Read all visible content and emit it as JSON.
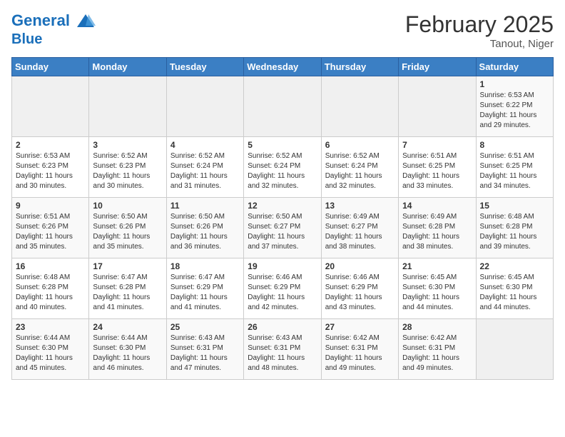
{
  "header": {
    "logo_line1": "General",
    "logo_line2": "Blue",
    "month_year": "February 2025",
    "location": "Tanout, Niger"
  },
  "weekdays": [
    "Sunday",
    "Monday",
    "Tuesday",
    "Wednesday",
    "Thursday",
    "Friday",
    "Saturday"
  ],
  "weeks": [
    [
      {
        "day": "",
        "info": ""
      },
      {
        "day": "",
        "info": ""
      },
      {
        "day": "",
        "info": ""
      },
      {
        "day": "",
        "info": ""
      },
      {
        "day": "",
        "info": ""
      },
      {
        "day": "",
        "info": ""
      },
      {
        "day": "1",
        "info": "Sunrise: 6:53 AM\nSunset: 6:22 PM\nDaylight: 11 hours and 29 minutes."
      }
    ],
    [
      {
        "day": "2",
        "info": "Sunrise: 6:53 AM\nSunset: 6:23 PM\nDaylight: 11 hours and 30 minutes."
      },
      {
        "day": "3",
        "info": "Sunrise: 6:52 AM\nSunset: 6:23 PM\nDaylight: 11 hours and 30 minutes."
      },
      {
        "day": "4",
        "info": "Sunrise: 6:52 AM\nSunset: 6:24 PM\nDaylight: 11 hours and 31 minutes."
      },
      {
        "day": "5",
        "info": "Sunrise: 6:52 AM\nSunset: 6:24 PM\nDaylight: 11 hours and 32 minutes."
      },
      {
        "day": "6",
        "info": "Sunrise: 6:52 AM\nSunset: 6:24 PM\nDaylight: 11 hours and 32 minutes."
      },
      {
        "day": "7",
        "info": "Sunrise: 6:51 AM\nSunset: 6:25 PM\nDaylight: 11 hours and 33 minutes."
      },
      {
        "day": "8",
        "info": "Sunrise: 6:51 AM\nSunset: 6:25 PM\nDaylight: 11 hours and 34 minutes."
      }
    ],
    [
      {
        "day": "9",
        "info": "Sunrise: 6:51 AM\nSunset: 6:26 PM\nDaylight: 11 hours and 35 minutes."
      },
      {
        "day": "10",
        "info": "Sunrise: 6:50 AM\nSunset: 6:26 PM\nDaylight: 11 hours and 35 minutes."
      },
      {
        "day": "11",
        "info": "Sunrise: 6:50 AM\nSunset: 6:26 PM\nDaylight: 11 hours and 36 minutes."
      },
      {
        "day": "12",
        "info": "Sunrise: 6:50 AM\nSunset: 6:27 PM\nDaylight: 11 hours and 37 minutes."
      },
      {
        "day": "13",
        "info": "Sunrise: 6:49 AM\nSunset: 6:27 PM\nDaylight: 11 hours and 38 minutes."
      },
      {
        "day": "14",
        "info": "Sunrise: 6:49 AM\nSunset: 6:28 PM\nDaylight: 11 hours and 38 minutes."
      },
      {
        "day": "15",
        "info": "Sunrise: 6:48 AM\nSunset: 6:28 PM\nDaylight: 11 hours and 39 minutes."
      }
    ],
    [
      {
        "day": "16",
        "info": "Sunrise: 6:48 AM\nSunset: 6:28 PM\nDaylight: 11 hours and 40 minutes."
      },
      {
        "day": "17",
        "info": "Sunrise: 6:47 AM\nSunset: 6:28 PM\nDaylight: 11 hours and 41 minutes."
      },
      {
        "day": "18",
        "info": "Sunrise: 6:47 AM\nSunset: 6:29 PM\nDaylight: 11 hours and 41 minutes."
      },
      {
        "day": "19",
        "info": "Sunrise: 6:46 AM\nSunset: 6:29 PM\nDaylight: 11 hours and 42 minutes."
      },
      {
        "day": "20",
        "info": "Sunrise: 6:46 AM\nSunset: 6:29 PM\nDaylight: 11 hours and 43 minutes."
      },
      {
        "day": "21",
        "info": "Sunrise: 6:45 AM\nSunset: 6:30 PM\nDaylight: 11 hours and 44 minutes."
      },
      {
        "day": "22",
        "info": "Sunrise: 6:45 AM\nSunset: 6:30 PM\nDaylight: 11 hours and 44 minutes."
      }
    ],
    [
      {
        "day": "23",
        "info": "Sunrise: 6:44 AM\nSunset: 6:30 PM\nDaylight: 11 hours and 45 minutes."
      },
      {
        "day": "24",
        "info": "Sunrise: 6:44 AM\nSunset: 6:30 PM\nDaylight: 11 hours and 46 minutes."
      },
      {
        "day": "25",
        "info": "Sunrise: 6:43 AM\nSunset: 6:31 PM\nDaylight: 11 hours and 47 minutes."
      },
      {
        "day": "26",
        "info": "Sunrise: 6:43 AM\nSunset: 6:31 PM\nDaylight: 11 hours and 48 minutes."
      },
      {
        "day": "27",
        "info": "Sunrise: 6:42 AM\nSunset: 6:31 PM\nDaylight: 11 hours and 49 minutes."
      },
      {
        "day": "28",
        "info": "Sunrise: 6:42 AM\nSunset: 6:31 PM\nDaylight: 11 hours and 49 minutes."
      },
      {
        "day": "",
        "info": ""
      }
    ]
  ]
}
